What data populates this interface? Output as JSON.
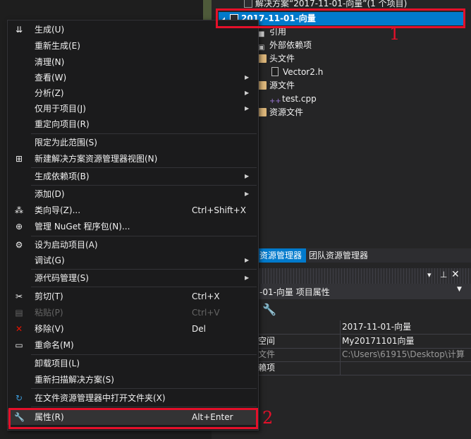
{
  "solution_explorer": {
    "solution_label": "解决方案“2017-11-01-向量”(1 个项目)",
    "project_label": "2017-11-01-向量",
    "items": [
      {
        "label": "引用",
        "icon": "references-icon"
      },
      {
        "label": "外部依赖项",
        "icon": "external-deps-icon"
      },
      {
        "label": "头文件",
        "icon": "folder-icon"
      },
      {
        "label": "Vector2.h",
        "icon": "header-file-icon"
      },
      {
        "label": "源文件",
        "icon": "folder-icon"
      },
      {
        "label": "test.cpp",
        "icon": "cpp-file-icon"
      },
      {
        "label": "资源文件",
        "icon": "folder-icon"
      }
    ]
  },
  "tabs": {
    "solution_explorer": "资源管理器",
    "team_explorer": "团队资源管理器"
  },
  "properties": {
    "title": "-01-向量  项目属性",
    "rows": [
      {
        "key": "",
        "value": "2017-11-01-向量"
      },
      {
        "key": "空间",
        "value": "My20171101向量"
      },
      {
        "key": "文件",
        "value": "C:\\Users\\61915\\Desktop\\计算"
      },
      {
        "key": "赖项",
        "value": ""
      }
    ]
  },
  "context_menu": {
    "items": [
      {
        "label": "生成(U)",
        "shortcut": "",
        "icon": "build-icon"
      },
      {
        "label": "重新生成(E)",
        "shortcut": ""
      },
      {
        "label": "清理(N)",
        "shortcut": ""
      },
      {
        "label": "查看(W)",
        "shortcut": "",
        "submenu": true
      },
      {
        "label": "分析(Z)",
        "shortcut": "",
        "submenu": true
      },
      {
        "label": "仅用于项目(J)",
        "shortcut": "",
        "submenu": true
      },
      {
        "label": "重定向项目(R)",
        "shortcut": ""
      },
      {
        "label": "限定为此范围(S)",
        "shortcut": ""
      },
      {
        "label": "新建解决方案资源管理器视图(N)",
        "shortcut": "",
        "icon": "new-view-icon"
      },
      {
        "label": "生成依赖项(B)",
        "shortcut": "",
        "submenu": true
      },
      {
        "label": "添加(D)",
        "shortcut": "",
        "submenu": true
      },
      {
        "label": "类向导(Z)...",
        "shortcut": "Ctrl+Shift+X",
        "icon": "class-wizard-icon"
      },
      {
        "label": "管理 NuGet 程序包(N)...",
        "shortcut": "",
        "icon": "nuget-icon"
      },
      {
        "label": "设为启动项目(A)",
        "shortcut": "",
        "icon": "gear-icon"
      },
      {
        "label": "调试(G)",
        "shortcut": "",
        "submenu": true
      },
      {
        "label": "源代码管理(S)",
        "shortcut": "",
        "submenu": true
      },
      {
        "label": "剪切(T)",
        "shortcut": "Ctrl+X",
        "icon": "scissors-icon"
      },
      {
        "label": "粘贴(P)",
        "shortcut": "Ctrl+V",
        "icon": "paste-icon",
        "disabled": true
      },
      {
        "label": "移除(V)",
        "shortcut": "Del",
        "icon": "remove-icon"
      },
      {
        "label": "重命名(M)",
        "shortcut": "",
        "icon": "rename-icon"
      },
      {
        "label": "卸载项目(L)",
        "shortcut": ""
      },
      {
        "label": "重新扫描解决方案(S)",
        "shortcut": ""
      },
      {
        "label": "在文件资源管理器中打开文件夹(X)",
        "shortcut": "",
        "icon": "open-folder-icon"
      },
      {
        "label": "属性(R)",
        "shortcut": "Alt+Enter",
        "icon": "wrench-icon"
      }
    ]
  },
  "annotations": {
    "mark_1": "1",
    "mark_2": "2"
  },
  "colors": {
    "selection": "#007acc",
    "annotation_red": "#e4102a",
    "menu_bg": "#1b1b1c"
  }
}
